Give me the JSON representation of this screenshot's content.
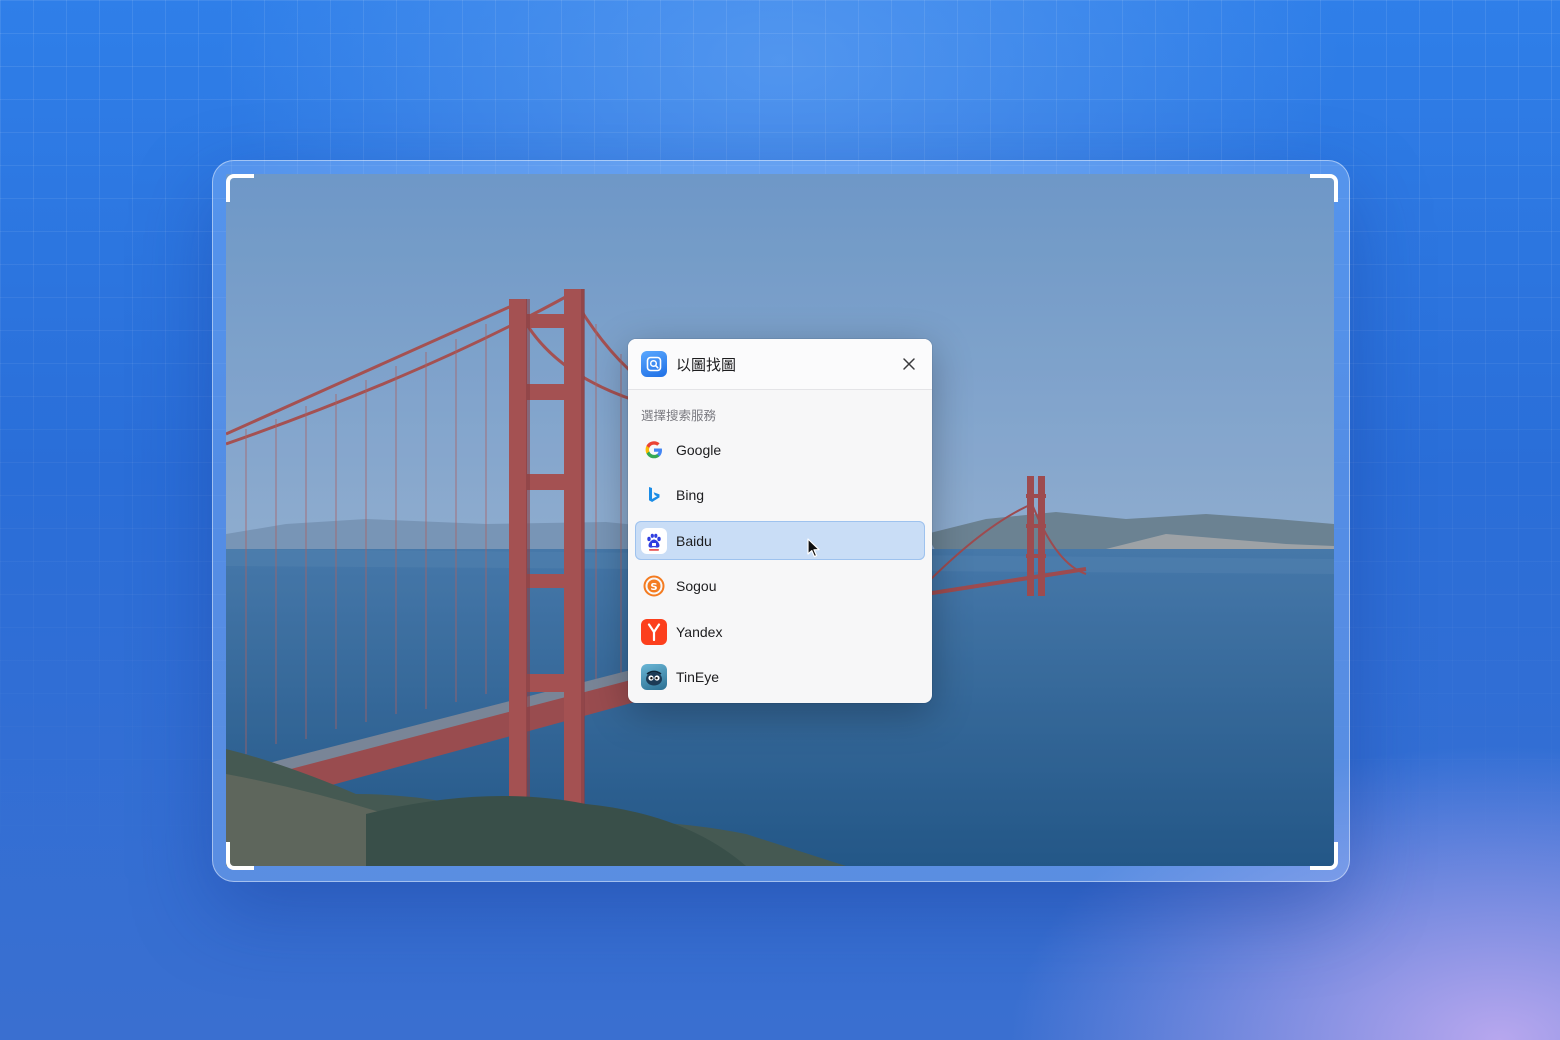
{
  "dialog": {
    "title": "以圖找圖",
    "app_icon": "image-search-icon",
    "close_icon": "close-icon",
    "section_label": "選擇搜索服務",
    "selected_index": 2,
    "services": [
      {
        "label": "Google",
        "icon": "google-icon"
      },
      {
        "label": "Bing",
        "icon": "bing-icon"
      },
      {
        "label": "Baidu",
        "icon": "baidu-icon"
      },
      {
        "label": "Sogou",
        "icon": "sogou-icon"
      },
      {
        "label": "Yandex",
        "icon": "yandex-icon"
      },
      {
        "label": "TinEye",
        "icon": "tineye-icon"
      }
    ]
  },
  "colors": {
    "background_top": "#2f7fe9",
    "background_bottom_right": "#beaaf0",
    "selection": "#c9ddf6",
    "google_blue": "#4285f4",
    "bing_blue": "#1b8ce6",
    "baidu_blue": "#2f3ee0",
    "sogou_orange": "#f47b20",
    "yandex_red": "#fc3f1d",
    "tineye_teal": "#3a8fb0"
  }
}
